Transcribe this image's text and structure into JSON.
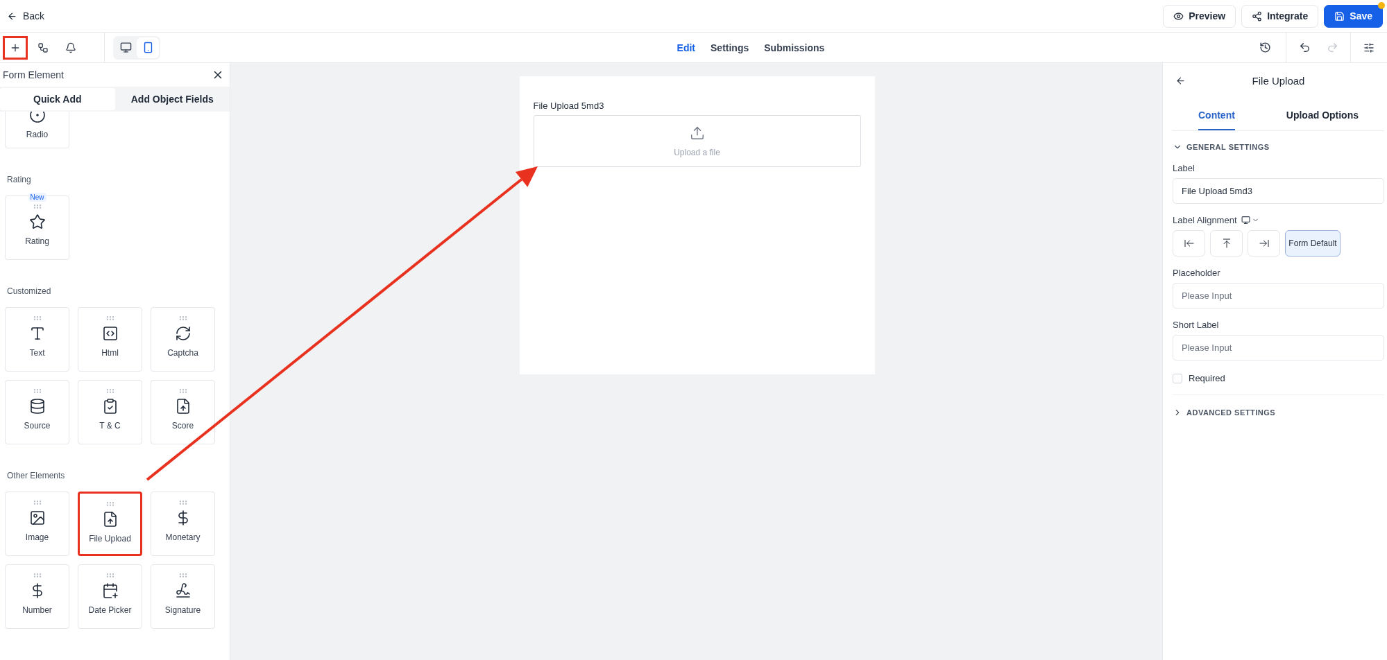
{
  "top_bar": {
    "back": "Back",
    "actions": [
      {
        "kind": "preview",
        "label": "Preview",
        "primary": false,
        "unsaved": false
      },
      {
        "kind": "integrate",
        "label": "Integrate",
        "primary": false,
        "unsaved": false
      },
      {
        "kind": "save",
        "label": "Save",
        "primary": true,
        "unsaved": true
      }
    ]
  },
  "toolbar": {
    "tools": [
      {
        "kind": "add",
        "highlighted": true
      },
      {
        "kind": "structure",
        "highlighted": false
      },
      {
        "kind": "notifications",
        "highlighted": false
      }
    ],
    "devices": [
      {
        "kind": "desktop",
        "selected": false
      },
      {
        "kind": "mobile",
        "selected": true
      }
    ],
    "tabs": [
      {
        "label": "Edit",
        "selected": true
      },
      {
        "label": "Settings",
        "selected": false
      },
      {
        "label": "Submissions",
        "selected": false
      }
    ],
    "history": [
      {
        "kind": "undo",
        "disabled": false
      },
      {
        "kind": "redo",
        "disabled": true
      }
    ]
  },
  "element_panel": {
    "title": "Form Element",
    "tabs": [
      {
        "label": "Quick Add",
        "selected": true
      },
      {
        "label": "Add Object Fields",
        "selected": false
      }
    ],
    "sections": [
      {
        "items": [
          {
            "kind": "radio",
            "label": "Radio",
            "highlighted": false,
            "cut_off": true
          }
        ]
      },
      {
        "title": "Rating",
        "items": [
          {
            "kind": "star",
            "label": "Rating",
            "badge": "New",
            "highlighted": false
          }
        ]
      },
      {
        "title": "Customized",
        "items": [
          {
            "kind": "text",
            "label": "Text",
            "highlighted": false
          },
          {
            "kind": "html",
            "label": "Html",
            "highlighted": false
          },
          {
            "kind": "captcha",
            "label": "Captcha",
            "highlighted": false
          },
          {
            "kind": "source",
            "label": "Source",
            "highlighted": false
          },
          {
            "kind": "terms",
            "label": "T & C",
            "highlighted": false
          },
          {
            "kind": "score",
            "label": "Score",
            "highlighted": false
          }
        ]
      },
      {
        "title": "Other Elements",
        "items": [
          {
            "kind": "image",
            "label": "Image",
            "highlighted": false
          },
          {
            "kind": "upload",
            "label": "File Upload",
            "highlighted": true
          },
          {
            "kind": "money",
            "label": "Monetary",
            "highlighted": false
          },
          {
            "kind": "money",
            "label": "Number",
            "highlighted": false
          },
          {
            "kind": "date",
            "label": "Date Picker",
            "highlighted": false
          },
          {
            "kind": "signature",
            "label": "Signature",
            "highlighted": false
          }
        ]
      }
    ]
  },
  "canvas": {
    "field": {
      "label": "File Upload 5md3",
      "prompt": "Upload a file"
    }
  },
  "properties": {
    "title": "File Upload",
    "tabs": [
      {
        "label": "Content",
        "selected": true
      },
      {
        "label": "Upload Options",
        "selected": false
      }
    ],
    "general": {
      "title": "GENERAL SETTINGS",
      "expanded": true
    },
    "label": {
      "caption": "Label",
      "value": "File Upload 5md3"
    },
    "alignment": {
      "caption": "Label Alignment",
      "options": [
        {
          "kind": "left",
          "selected": false
        },
        {
          "kind": "top",
          "selected": false
        },
        {
          "kind": "right",
          "selected": false
        },
        {
          "kind": "default",
          "label": "Form Default",
          "selected": true
        }
      ]
    },
    "placeholder": {
      "caption": "Placeholder",
      "placeholder": "Please Input"
    },
    "short_label": {
      "caption": "Short Label",
      "placeholder": "Please Input"
    },
    "required": {
      "label": "Required",
      "checked": false
    },
    "advanced": {
      "title": "ADVANCED SETTINGS",
      "expanded": false
    }
  }
}
